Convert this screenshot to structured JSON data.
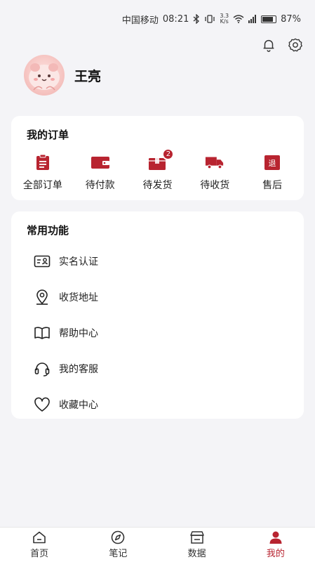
{
  "status_bar": {
    "carrier": "中国移动",
    "time": "08:21",
    "net_speed_top": "3.3",
    "net_speed_bottom": "K/s",
    "battery": "87%"
  },
  "profile": {
    "name": "王亮"
  },
  "orders": {
    "title": "我的订单",
    "items": [
      {
        "label": "全部订单",
        "icon": "clipboard-icon"
      },
      {
        "label": "待付款",
        "icon": "wallet-icon"
      },
      {
        "label": "待发货",
        "icon": "package-icon",
        "badge": "2"
      },
      {
        "label": "待收货",
        "icon": "truck-icon"
      },
      {
        "label": "售后",
        "icon": "return-icon",
        "icon_text": "退"
      }
    ]
  },
  "functions": {
    "title": "常用功能",
    "items": [
      {
        "label": "实名认证",
        "icon": "id-card-icon"
      },
      {
        "label": "收货地址",
        "icon": "location-pin-icon"
      },
      {
        "label": "帮助中心",
        "icon": "book-icon"
      },
      {
        "label": "我的客服",
        "icon": "headset-icon"
      },
      {
        "label": "收藏中心",
        "icon": "heart-icon"
      }
    ]
  },
  "bottom_nav": {
    "items": [
      {
        "label": "首页",
        "icon": "home-icon"
      },
      {
        "label": "笔记",
        "icon": "compass-icon"
      },
      {
        "label": "数据",
        "icon": "store-icon"
      },
      {
        "label": "我的",
        "icon": "user-icon",
        "active": true
      }
    ]
  },
  "colors": {
    "accent": "#b82430",
    "background": "#f4f4f7",
    "card": "#ffffff"
  }
}
